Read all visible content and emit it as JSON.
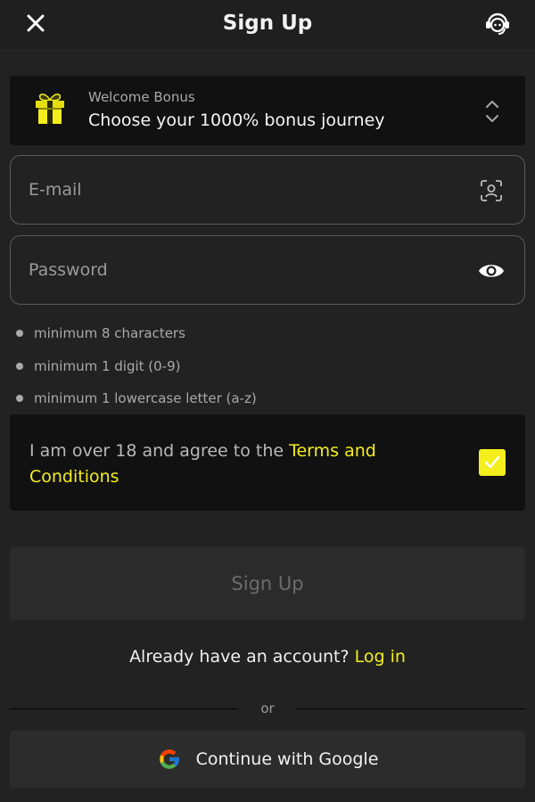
{
  "header": {
    "title": "Sign Up",
    "close_icon": "close-icon",
    "support_icon": "headset-support-icon"
  },
  "bonus": {
    "label": "Welcome Bonus",
    "value": "Choose your 1000% bonus journey",
    "icon": "gift-icon",
    "toggle_icon": "chevron-up-down-icon"
  },
  "email": {
    "placeholder": "E-mail",
    "value": "",
    "icon": "face-scan-icon"
  },
  "password": {
    "placeholder": "Password",
    "value": "",
    "icon": "eye-icon"
  },
  "password_rules": [
    "minimum 8 characters",
    "minimum 1 digit (0-9)",
    "minimum 1 lowercase letter (a-z)"
  ],
  "terms": {
    "text": "I am over 18 and agree to the ",
    "link": "Terms and Conditions",
    "checked": true
  },
  "signup_button": "Sign Up",
  "login": {
    "prompt": "Already have an account? ",
    "link": "Log in"
  },
  "divider_text": "or",
  "google_button": "Continue with Google",
  "colors": {
    "accent": "#f4ee1c",
    "background": "#222222",
    "panel": "#111111"
  }
}
